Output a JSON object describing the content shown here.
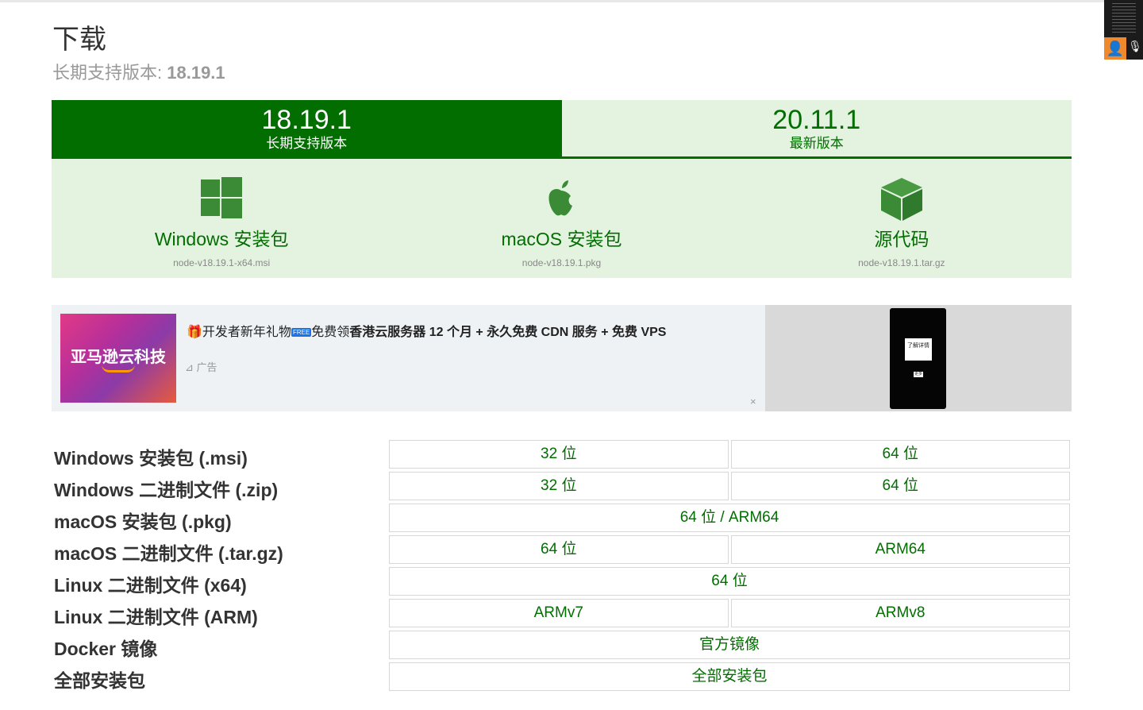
{
  "header": {
    "title": "下载",
    "subtitle_prefix": "长期支持版本:",
    "subtitle_version": "18.19.1"
  },
  "tabs": [
    {
      "version": "18.19.1",
      "label": "长期支持版本",
      "active": true
    },
    {
      "version": "20.11.1",
      "label": "最新版本",
      "active": false
    }
  ],
  "downloads": [
    {
      "icon": "windows-icon",
      "name": "Windows 安装包",
      "file": "node-v18.19.1-x64.msi"
    },
    {
      "icon": "apple-icon",
      "name": "macOS 安装包",
      "file": "node-v18.19.1.pkg"
    },
    {
      "icon": "package-box-icon",
      "name": "源代码",
      "file": "node-v18.19.1.tar.gz"
    }
  ],
  "ad": {
    "image_text": "亚马逊云科技",
    "text_gift": "🎁",
    "text_part1": "开发者新年礼物",
    "free_badge": "FREE",
    "text_part2": "免费领",
    "text_bold": "香港云服务器 12 个月 + 永久免费 CDN 服务 + 免费 VPS",
    "label": "广告",
    "close": "×",
    "phone_btn1": "了解详情",
    "phone_btn2": "更多"
  },
  "table": [
    {
      "label": "Windows 安装包 (.msi)",
      "cells": [
        "32 位",
        "64 位"
      ]
    },
    {
      "label": "Windows 二进制文件 (.zip)",
      "cells": [
        "32 位",
        "64 位"
      ]
    },
    {
      "label": "macOS 安装包 (.pkg)",
      "cells": [
        "64 位 / ARM64"
      ]
    },
    {
      "label": "macOS 二进制文件 (.tar.gz)",
      "cells": [
        "64 位",
        "ARM64"
      ]
    },
    {
      "label": "Linux 二进制文件 (x64)",
      "cells": [
        "64 位"
      ]
    },
    {
      "label": "Linux 二进制文件 (ARM)",
      "cells": [
        "ARMv7",
        "ARMv8"
      ]
    },
    {
      "label": "Docker 镜像",
      "cells": [
        "官方镜像"
      ]
    },
    {
      "label": "全部安装包",
      "cells": [
        "全部安装包"
      ]
    }
  ],
  "colors": {
    "brand_green": "#026e00",
    "light_green": "#e3f3e0"
  }
}
